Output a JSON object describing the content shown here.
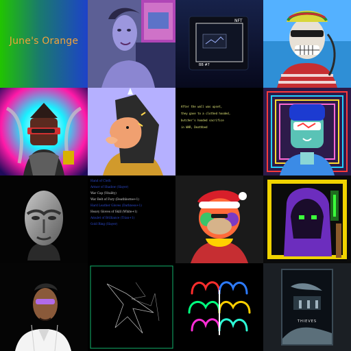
{
  "tiles": {
    "t1": {
      "text": "June's Orange"
    },
    "t3": {
      "badge": "NFT",
      "caption": "BB #7"
    },
    "t7": {
      "lines": [
        "After the wall was upset,",
        "they gave to a clothed hooded,",
        "butcher's hooded sacrifice",
        "in WAR, Deathbed"
      ]
    },
    "t10": {
      "items": [
        {
          "text": "Hand of Cloth",
          "color": "#2e4dd8"
        },
        {
          "text": "Armor of Shadow (Slayer)",
          "color": "#2e4dd8"
        },
        {
          "text": "War Cap (Vitality)",
          "color": "#d7d7d7"
        },
        {
          "text": "War Belt of Fury (Deathborne+1)",
          "color": "#d7d7d7"
        },
        {
          "text": "Hard Leather Gloves (Darkness+1)",
          "color": "#2e4dd8"
        },
        {
          "text": "Heavy Gloves of Skill (White+1)",
          "color": "#d7d7d7"
        },
        {
          "text": "Amulet of Brilliance (Titan+1)",
          "color": "#2e4dd8"
        },
        {
          "text": "Gold Ring (Slayer)",
          "color": "#2e4dd8"
        }
      ]
    },
    "t16": {
      "title": "THIEVES"
    }
  }
}
